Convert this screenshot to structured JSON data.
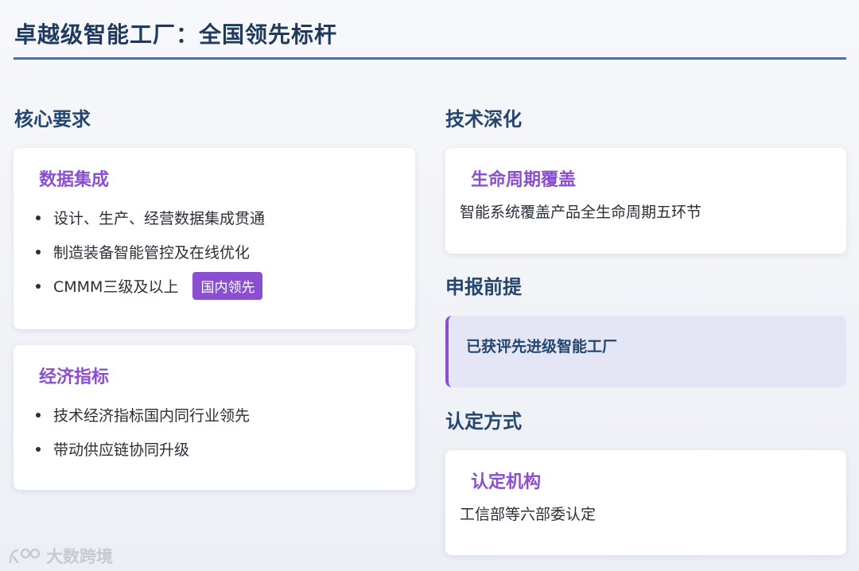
{
  "page": {
    "title": "卓越级智能工厂：全国领先标杆"
  },
  "left": {
    "heading": "核心要求",
    "card1": {
      "title": "数据集成",
      "items": [
        "设计、生产、经营数据集成贯通",
        "制造装备智能管控及在线优化",
        "CMMM三级及以上"
      ],
      "badge": "国内领先"
    },
    "card2": {
      "title": "经济指标",
      "items": [
        "技术经济指标国内同行业领先",
        "带动供应链协同升级"
      ]
    }
  },
  "right": {
    "section1": {
      "heading": "技术深化",
      "card_title": "生命周期覆盖",
      "card_text": "智能系统覆盖产品全生命周期五环节"
    },
    "section2": {
      "heading": "申报前提",
      "callout": "已获评先进级智能工厂"
    },
    "section3": {
      "heading": "认定方式",
      "card_title": "认定机构",
      "card_text": "工信部等六部委认定"
    }
  },
  "watermark": {
    "text": "大数跨境",
    "icon": "brand-logo-icon"
  },
  "colors": {
    "title": "#1e3a5f",
    "heading": "#24456e",
    "accent_purple": "#8a4fd0",
    "rule": "#4f6fa0",
    "callout_bg": "#e5e6f5"
  }
}
